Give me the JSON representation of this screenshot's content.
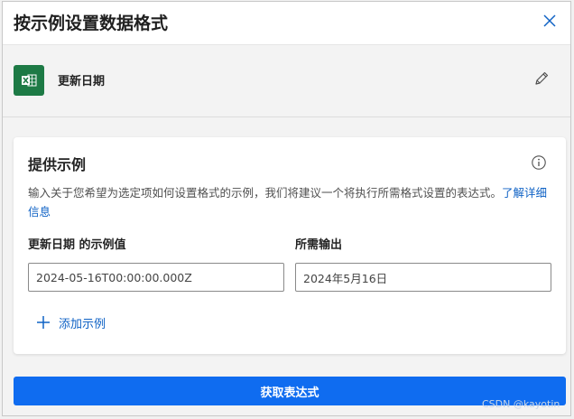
{
  "dialog": {
    "title": "按示例设置数据格式",
    "close_icon": "close-icon"
  },
  "column": {
    "icon": "excel-icon",
    "name": "更新日期",
    "edit_icon": "pencil-icon"
  },
  "card": {
    "title": "提供示例",
    "info_icon": "info-icon",
    "description": "输入关于您希望为选定项如何设置格式的示例，我们将建议一个将执行所需格式设置的表达式。",
    "learn_more": "了解详细信息",
    "example_label": "更新日期 的示例值",
    "output_label": "所需输出",
    "example_value": "2024-05-16T00:00:00.000Z",
    "output_value": "2024年5月16日",
    "add_example": "添加示例",
    "add_icon": "plus-icon"
  },
  "actions": {
    "primary_label": "获取表达式"
  },
  "watermark": "CSDN @kayotin",
  "colors": {
    "accent": "#0f6cf0",
    "link": "#0f62c5",
    "excel_green": "#1d7a45"
  }
}
